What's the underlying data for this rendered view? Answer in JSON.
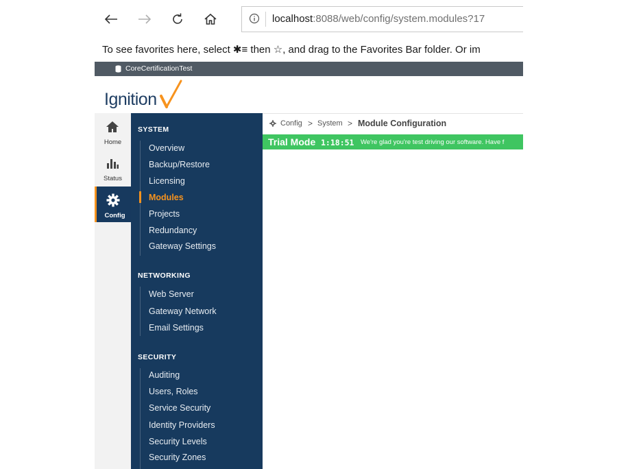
{
  "browser": {
    "url_host": "localhost",
    "url_rest": ":8088/web/config/system.modules?17",
    "favorites_bar_text": "To see favorites here, select  ✱≡  then ☆, and drag to the Favorites Bar folder. Or im",
    "tab_title": "CoreCertificationTest"
  },
  "logo": {
    "text": "Ignition",
    "accent_color": "#f7931e"
  },
  "rail": {
    "home_label": "Home",
    "status_label": "Status",
    "config_label": "Config"
  },
  "nav": {
    "system_heading": "SYSTEM",
    "system_items": [
      "Overview",
      "Backup/Restore",
      "Licensing",
      "Modules",
      "Projects",
      "Redundancy",
      "Gateway Settings"
    ],
    "networking_heading": "NETWORKING",
    "networking_items": [
      "Web Server",
      "Gateway Network",
      "Email Settings"
    ],
    "security_heading": "SECURITY",
    "security_items": [
      "Auditing",
      "Users, Roles",
      "Service Security",
      "Identity Providers",
      "Security Levels",
      "Security Zones"
    ],
    "active_item": "Modules"
  },
  "breadcrumb": {
    "config": "Config",
    "system": "System",
    "current": "Module Configuration",
    "separator": ">"
  },
  "trial": {
    "mode_label": "Trial Mode",
    "time_remaining": "1:18:51",
    "message": "We're glad you're test driving our software. Have f"
  },
  "colors": {
    "nav_bg": "#173a5e",
    "trial_green": "#3fc561",
    "active_orange": "#f7931e"
  }
}
